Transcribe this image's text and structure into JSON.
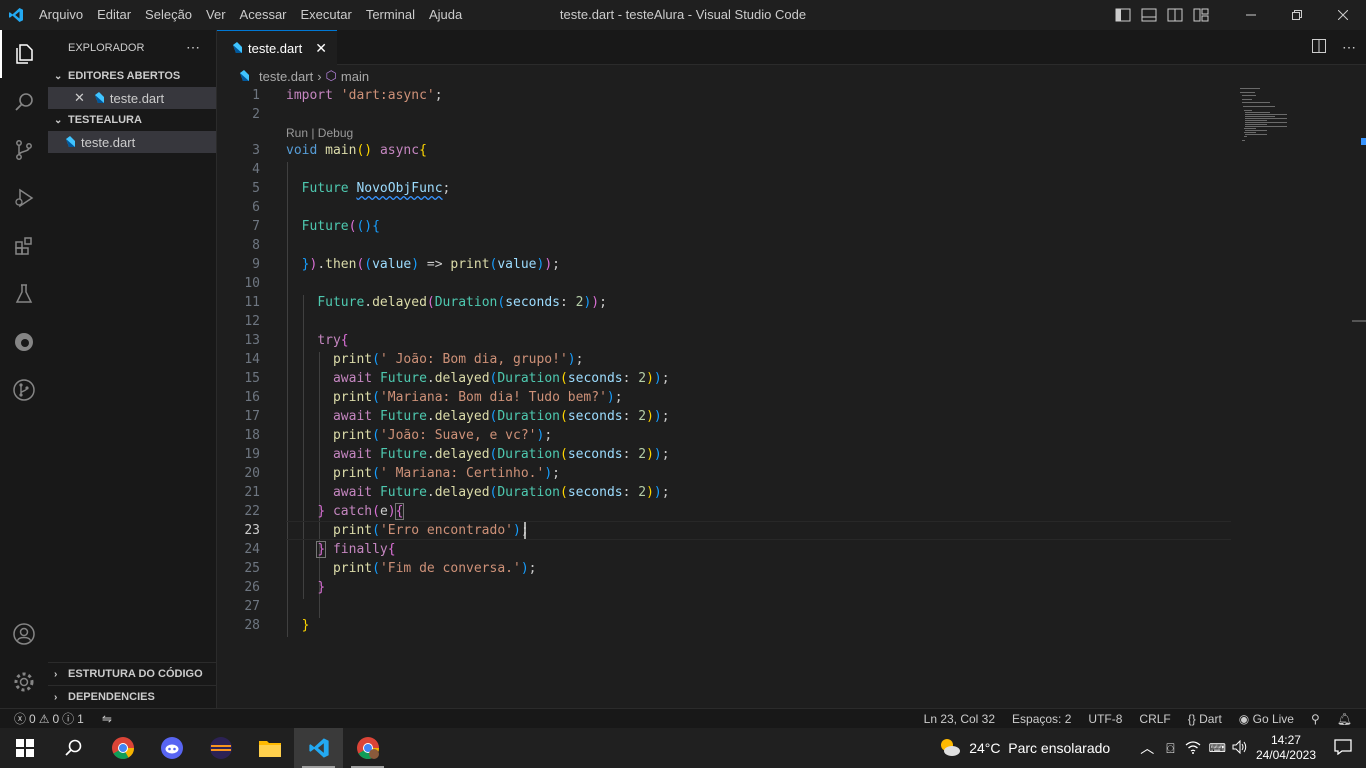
{
  "titlebar": {
    "menu": [
      "Arquivo",
      "Editar",
      "Seleção",
      "Ver",
      "Acessar",
      "Executar",
      "Terminal",
      "Ajuda"
    ],
    "title": "teste.dart - testeAlura - Visual Studio Code"
  },
  "sidebar": {
    "header": "EXPLORADOR",
    "open_editors_title": "EDITORES ABERTOS",
    "open_file": "teste.dart",
    "project_title": "TESTEALURA",
    "project_file": "teste.dart",
    "outline_title": "ESTRUTURA DO CÓDIGO",
    "dependencies_title": "DEPENDENCIES"
  },
  "tab": {
    "label": "teste.dart"
  },
  "breadcrumb": {
    "file": "teste.dart",
    "symbol": "main"
  },
  "codelens": "Run | Debug",
  "status": {
    "errors": "0",
    "warnings": "0",
    "info": "1",
    "position": "Ln 23, Col 32",
    "spaces": "Espaços: 2",
    "encoding": "UTF-8",
    "eol": "CRLF",
    "language": "Dart",
    "golive": "Go Live"
  },
  "taskbar": {
    "weather": "24°C  Parc ensolarado",
    "time": "14:27",
    "date": "24/04/2023"
  },
  "colors": {
    "accent": "#0078d4",
    "bg": "#1e1e1e",
    "sidebar": "#181818"
  }
}
